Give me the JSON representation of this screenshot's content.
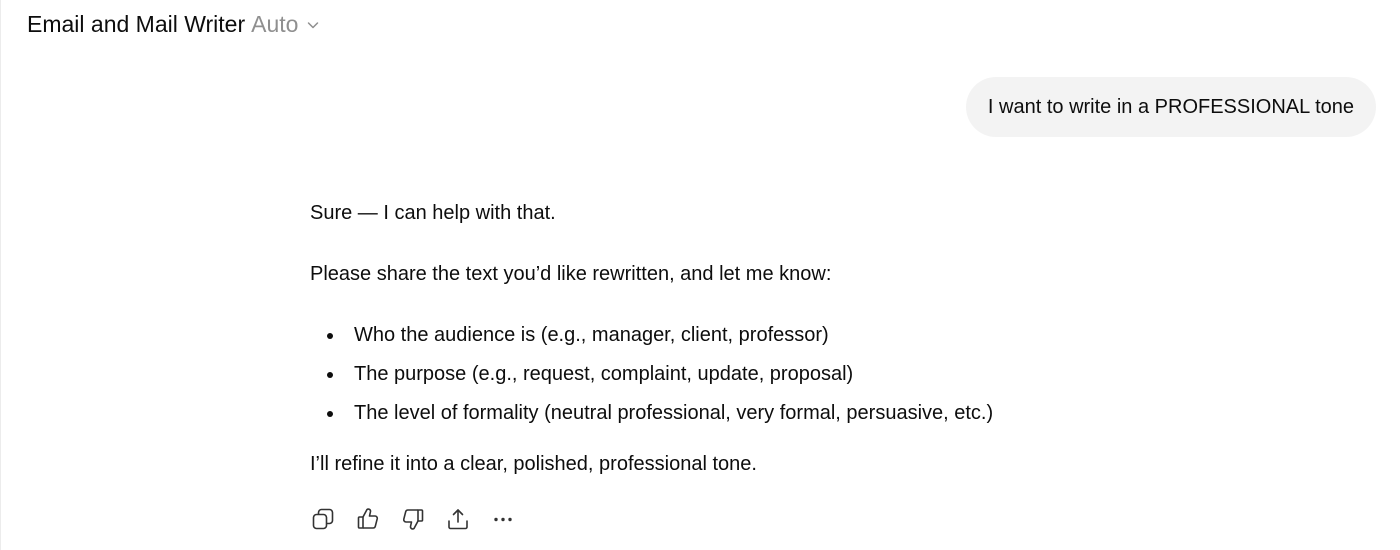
{
  "header": {
    "title": "Email and Mail Writer",
    "model": "Auto",
    "chevron_icon": "chevron-down-icon"
  },
  "user_message": {
    "text": "I want to write in a PROFESSIONAL tone"
  },
  "assistant_message": {
    "paragraph1": "Sure — I can help with that.",
    "paragraph2": "Please share the text you’d like rewritten, and let me know:",
    "bullets": [
      "Who the audience is (e.g., manager, client, professor)",
      "The purpose (e.g., request, complaint, update, proposal)",
      "The level of formality (neutral professional, very formal, persuasive, etc.)"
    ],
    "paragraph3": "I’ll refine it into a clear, polished, professional tone."
  },
  "actions": {
    "icons": [
      "copy-icon",
      "thumbs-up-icon",
      "thumbs-down-icon",
      "share-icon",
      "more-icon"
    ]
  },
  "colors": {
    "text": "#0d0d0d",
    "muted": "#8f8f8f",
    "bubble": "#f3f3f3"
  }
}
